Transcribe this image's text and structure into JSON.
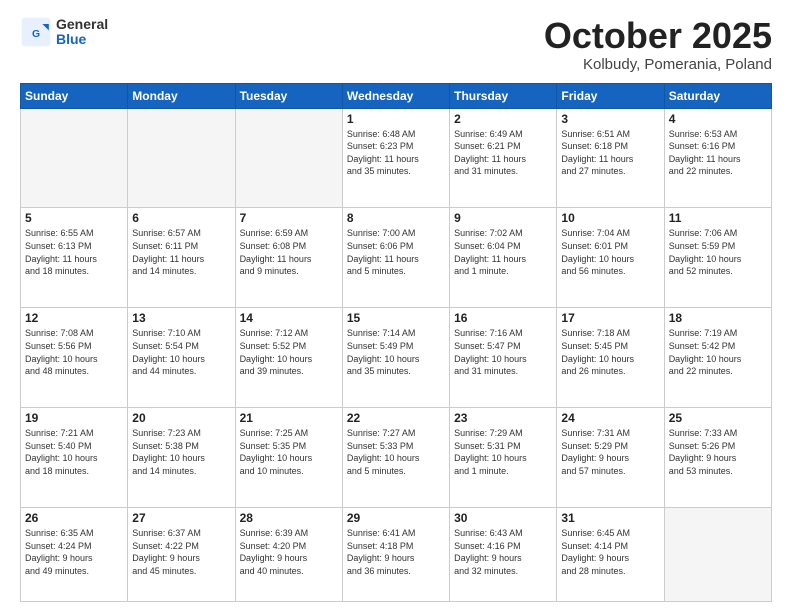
{
  "header": {
    "logo_general": "General",
    "logo_blue": "Blue",
    "month_title": "October 2025",
    "location": "Kolbudy, Pomerania, Poland"
  },
  "days_of_week": [
    "Sunday",
    "Monday",
    "Tuesday",
    "Wednesday",
    "Thursday",
    "Friday",
    "Saturday"
  ],
  "weeks": [
    [
      {
        "day": "",
        "info": ""
      },
      {
        "day": "",
        "info": ""
      },
      {
        "day": "",
        "info": ""
      },
      {
        "day": "1",
        "info": "Sunrise: 6:48 AM\nSunset: 6:23 PM\nDaylight: 11 hours\nand 35 minutes."
      },
      {
        "day": "2",
        "info": "Sunrise: 6:49 AM\nSunset: 6:21 PM\nDaylight: 11 hours\nand 31 minutes."
      },
      {
        "day": "3",
        "info": "Sunrise: 6:51 AM\nSunset: 6:18 PM\nDaylight: 11 hours\nand 27 minutes."
      },
      {
        "day": "4",
        "info": "Sunrise: 6:53 AM\nSunset: 6:16 PM\nDaylight: 11 hours\nand 22 minutes."
      }
    ],
    [
      {
        "day": "5",
        "info": "Sunrise: 6:55 AM\nSunset: 6:13 PM\nDaylight: 11 hours\nand 18 minutes."
      },
      {
        "day": "6",
        "info": "Sunrise: 6:57 AM\nSunset: 6:11 PM\nDaylight: 11 hours\nand 14 minutes."
      },
      {
        "day": "7",
        "info": "Sunrise: 6:59 AM\nSunset: 6:08 PM\nDaylight: 11 hours\nand 9 minutes."
      },
      {
        "day": "8",
        "info": "Sunrise: 7:00 AM\nSunset: 6:06 PM\nDaylight: 11 hours\nand 5 minutes."
      },
      {
        "day": "9",
        "info": "Sunrise: 7:02 AM\nSunset: 6:04 PM\nDaylight: 11 hours\nand 1 minute."
      },
      {
        "day": "10",
        "info": "Sunrise: 7:04 AM\nSunset: 6:01 PM\nDaylight: 10 hours\nand 56 minutes."
      },
      {
        "day": "11",
        "info": "Sunrise: 7:06 AM\nSunset: 5:59 PM\nDaylight: 10 hours\nand 52 minutes."
      }
    ],
    [
      {
        "day": "12",
        "info": "Sunrise: 7:08 AM\nSunset: 5:56 PM\nDaylight: 10 hours\nand 48 minutes."
      },
      {
        "day": "13",
        "info": "Sunrise: 7:10 AM\nSunset: 5:54 PM\nDaylight: 10 hours\nand 44 minutes."
      },
      {
        "day": "14",
        "info": "Sunrise: 7:12 AM\nSunset: 5:52 PM\nDaylight: 10 hours\nand 39 minutes."
      },
      {
        "day": "15",
        "info": "Sunrise: 7:14 AM\nSunset: 5:49 PM\nDaylight: 10 hours\nand 35 minutes."
      },
      {
        "day": "16",
        "info": "Sunrise: 7:16 AM\nSunset: 5:47 PM\nDaylight: 10 hours\nand 31 minutes."
      },
      {
        "day": "17",
        "info": "Sunrise: 7:18 AM\nSunset: 5:45 PM\nDaylight: 10 hours\nand 26 minutes."
      },
      {
        "day": "18",
        "info": "Sunrise: 7:19 AM\nSunset: 5:42 PM\nDaylight: 10 hours\nand 22 minutes."
      }
    ],
    [
      {
        "day": "19",
        "info": "Sunrise: 7:21 AM\nSunset: 5:40 PM\nDaylight: 10 hours\nand 18 minutes."
      },
      {
        "day": "20",
        "info": "Sunrise: 7:23 AM\nSunset: 5:38 PM\nDaylight: 10 hours\nand 14 minutes."
      },
      {
        "day": "21",
        "info": "Sunrise: 7:25 AM\nSunset: 5:35 PM\nDaylight: 10 hours\nand 10 minutes."
      },
      {
        "day": "22",
        "info": "Sunrise: 7:27 AM\nSunset: 5:33 PM\nDaylight: 10 hours\nand 5 minutes."
      },
      {
        "day": "23",
        "info": "Sunrise: 7:29 AM\nSunset: 5:31 PM\nDaylight: 10 hours\nand 1 minute."
      },
      {
        "day": "24",
        "info": "Sunrise: 7:31 AM\nSunset: 5:29 PM\nDaylight: 9 hours\nand 57 minutes."
      },
      {
        "day": "25",
        "info": "Sunrise: 7:33 AM\nSunset: 5:26 PM\nDaylight: 9 hours\nand 53 minutes."
      }
    ],
    [
      {
        "day": "26",
        "info": "Sunrise: 6:35 AM\nSunset: 4:24 PM\nDaylight: 9 hours\nand 49 minutes."
      },
      {
        "day": "27",
        "info": "Sunrise: 6:37 AM\nSunset: 4:22 PM\nDaylight: 9 hours\nand 45 minutes."
      },
      {
        "day": "28",
        "info": "Sunrise: 6:39 AM\nSunset: 4:20 PM\nDaylight: 9 hours\nand 40 minutes."
      },
      {
        "day": "29",
        "info": "Sunrise: 6:41 AM\nSunset: 4:18 PM\nDaylight: 9 hours\nand 36 minutes."
      },
      {
        "day": "30",
        "info": "Sunrise: 6:43 AM\nSunset: 4:16 PM\nDaylight: 9 hours\nand 32 minutes."
      },
      {
        "day": "31",
        "info": "Sunrise: 6:45 AM\nSunset: 4:14 PM\nDaylight: 9 hours\nand 28 minutes."
      },
      {
        "day": "",
        "info": ""
      }
    ]
  ]
}
